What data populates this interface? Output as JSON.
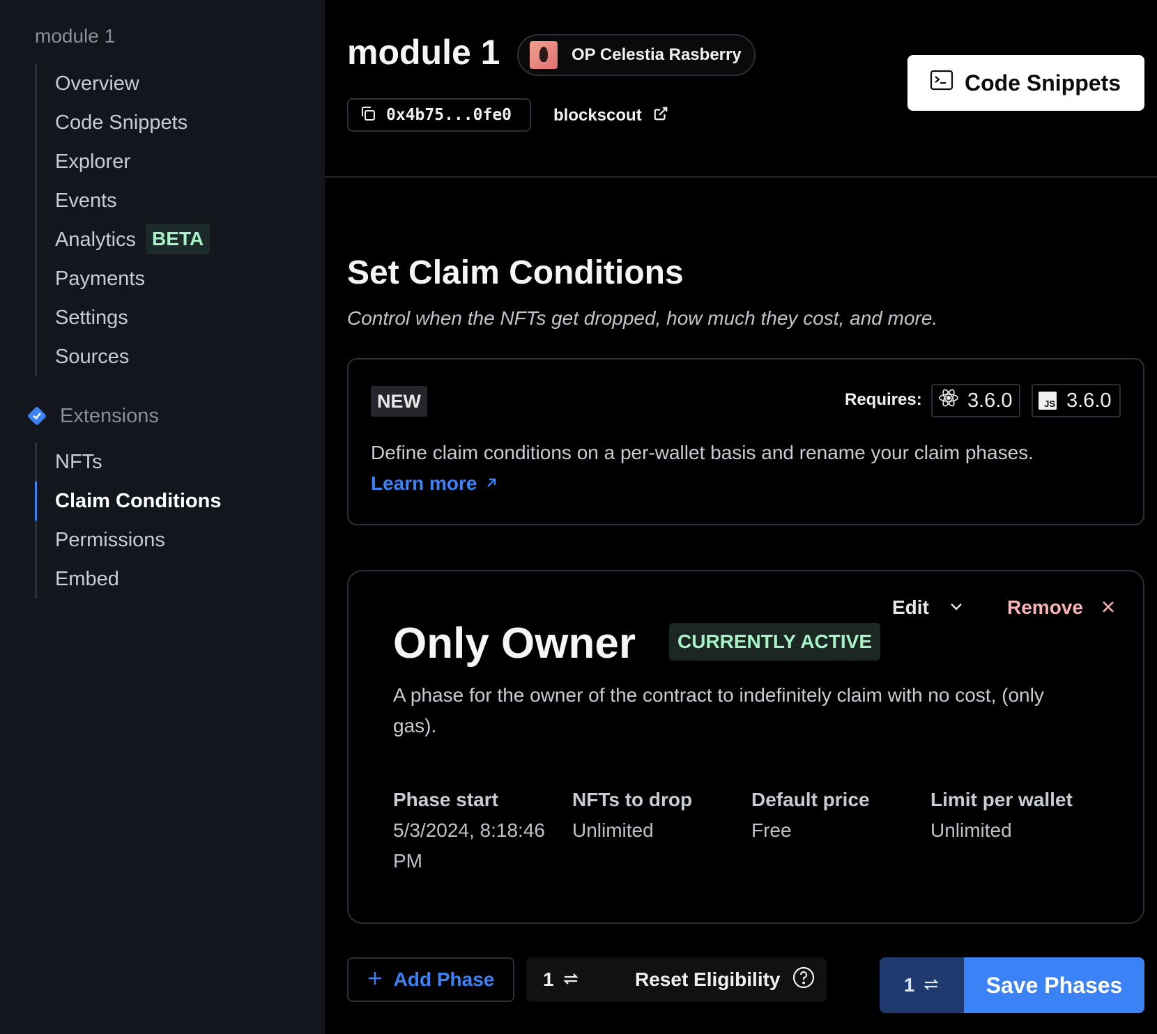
{
  "sidebar": {
    "module_label": "module 1",
    "items": [
      {
        "label": "Overview"
      },
      {
        "label": "Code Snippets"
      },
      {
        "label": "Explorer"
      },
      {
        "label": "Events"
      },
      {
        "label": "Analytics",
        "badge": "BETA"
      },
      {
        "label": "Payments"
      },
      {
        "label": "Settings"
      },
      {
        "label": "Sources"
      }
    ],
    "extensions_label": "Extensions",
    "extension_items": [
      {
        "label": "NFTs"
      },
      {
        "label": "Claim Conditions",
        "active": true
      },
      {
        "label": "Permissions"
      },
      {
        "label": "Embed"
      }
    ]
  },
  "header": {
    "title": "module 1",
    "chain_name": "OP Celestia Rasberry",
    "address": "0x4b75...0fe0",
    "explorer_label": "blockscout",
    "code_snippets_label": "Code Snippets"
  },
  "section": {
    "title": "Set Claim Conditions",
    "subtitle": "Control when the NFTs get dropped, how much they cost, and more."
  },
  "new_card": {
    "badge": "NEW",
    "requires_label": "Requires:",
    "react_version": "3.6.0",
    "js_version": "3.6.0",
    "js_icon_text": "JS",
    "description": "Define claim conditions on a per-wallet basis and rename your claim phases.",
    "learn_more": "Learn more"
  },
  "phase": {
    "edit_label": "Edit",
    "remove_label": "Remove",
    "name": "Only Owner",
    "status": "CURRENTLY ACTIVE",
    "description": "A phase for the owner of the contract to indefinitely claim with no cost, (only gas).",
    "stats": [
      {
        "label": "Phase start",
        "value": "5/3/2024, 8:18:46 PM"
      },
      {
        "label": "NFTs to drop",
        "value": "Unlimited"
      },
      {
        "label": "Default price",
        "value": "Free"
      },
      {
        "label": "Limit per wallet",
        "value": "Unlimited"
      }
    ]
  },
  "actions": {
    "add_phase": "Add Phase",
    "reset_count": "1",
    "reset_label": "Reset Eligibility",
    "save_count": "1",
    "save_label": "Save Phases"
  },
  "colors": {
    "accent": "#3b82f6",
    "success": "#a7f3c7",
    "danger": "#f8b4b4",
    "sidebar_bg": "#13161d"
  },
  "icons": [
    "diamond-check-icon",
    "chain-logo",
    "copy-icon",
    "external-link-icon",
    "terminal-icon",
    "react-icon",
    "js-icon",
    "arrow-up-right-icon",
    "chevron-down-icon",
    "close-icon",
    "plus-icon",
    "swap-icon",
    "help-icon"
  ]
}
